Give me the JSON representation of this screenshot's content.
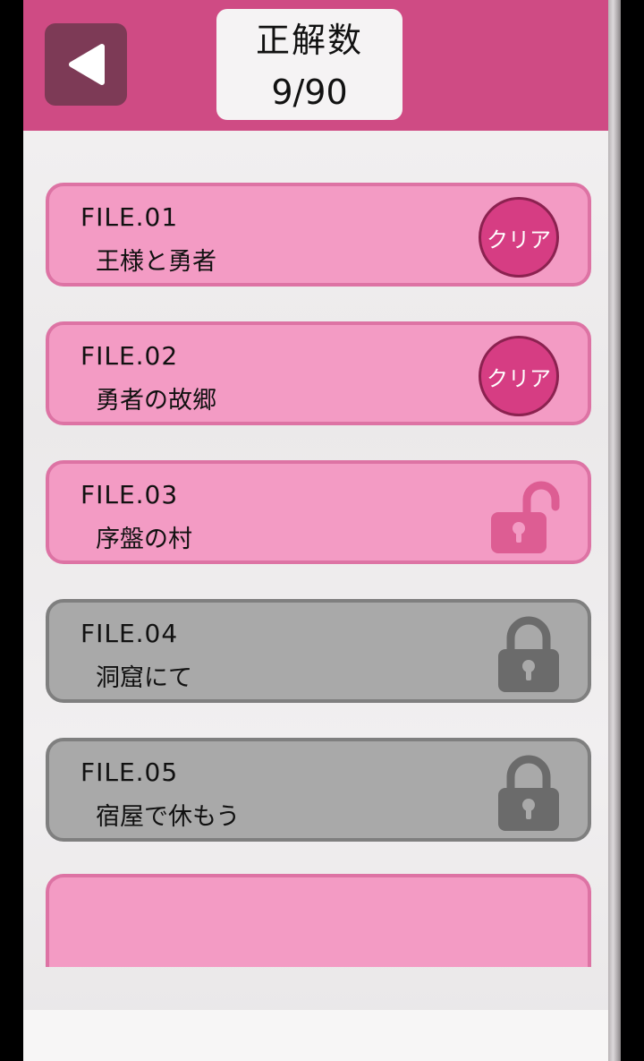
{
  "header": {
    "back_icon": "back-triangle-icon",
    "score_title": "正解数",
    "score_value": "9/90"
  },
  "files": [
    {
      "number": "FILE.01",
      "title": "王様と勇者",
      "status": "clear",
      "status_label": "クリア"
    },
    {
      "number": "FILE.02",
      "title": "勇者の故郷",
      "status": "clear",
      "status_label": "クリア"
    },
    {
      "number": "FILE.03",
      "title": "序盤の村",
      "status": "unlocked",
      "icon": "unlocked-padlock-icon"
    },
    {
      "number": "FILE.04",
      "title": "洞窟にて",
      "status": "locked",
      "icon": "padlock-icon"
    },
    {
      "number": "FILE.05",
      "title": "宿屋で休もう",
      "status": "locked",
      "icon": "padlock-icon"
    }
  ],
  "colors": {
    "header": "#cf4b84",
    "card_pink": "#f39bc4",
    "card_gray": "#a9a9a9",
    "badge": "#d63d83"
  }
}
